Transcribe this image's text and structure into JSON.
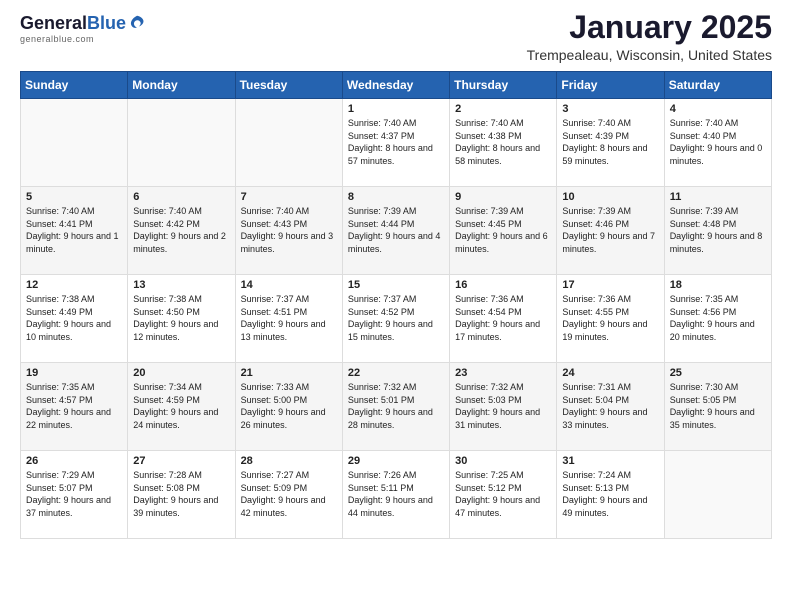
{
  "header": {
    "logo_general": "General",
    "logo_blue": "Blue",
    "month_title": "January 2025",
    "location": "Trempealeau, Wisconsin, United States"
  },
  "days_of_week": [
    "Sunday",
    "Monday",
    "Tuesday",
    "Wednesday",
    "Thursday",
    "Friday",
    "Saturday"
  ],
  "weeks": [
    [
      {
        "day": "",
        "info": ""
      },
      {
        "day": "",
        "info": ""
      },
      {
        "day": "",
        "info": ""
      },
      {
        "day": "1",
        "info": "Sunrise: 7:40 AM\nSunset: 4:37 PM\nDaylight: 8 hours and 57 minutes."
      },
      {
        "day": "2",
        "info": "Sunrise: 7:40 AM\nSunset: 4:38 PM\nDaylight: 8 hours and 58 minutes."
      },
      {
        "day": "3",
        "info": "Sunrise: 7:40 AM\nSunset: 4:39 PM\nDaylight: 8 hours and 59 minutes."
      },
      {
        "day": "4",
        "info": "Sunrise: 7:40 AM\nSunset: 4:40 PM\nDaylight: 9 hours and 0 minutes."
      }
    ],
    [
      {
        "day": "5",
        "info": "Sunrise: 7:40 AM\nSunset: 4:41 PM\nDaylight: 9 hours and 1 minute."
      },
      {
        "day": "6",
        "info": "Sunrise: 7:40 AM\nSunset: 4:42 PM\nDaylight: 9 hours and 2 minutes."
      },
      {
        "day": "7",
        "info": "Sunrise: 7:40 AM\nSunset: 4:43 PM\nDaylight: 9 hours and 3 minutes."
      },
      {
        "day": "8",
        "info": "Sunrise: 7:39 AM\nSunset: 4:44 PM\nDaylight: 9 hours and 4 minutes."
      },
      {
        "day": "9",
        "info": "Sunrise: 7:39 AM\nSunset: 4:45 PM\nDaylight: 9 hours and 6 minutes."
      },
      {
        "day": "10",
        "info": "Sunrise: 7:39 AM\nSunset: 4:46 PM\nDaylight: 9 hours and 7 minutes."
      },
      {
        "day": "11",
        "info": "Sunrise: 7:39 AM\nSunset: 4:48 PM\nDaylight: 9 hours and 8 minutes."
      }
    ],
    [
      {
        "day": "12",
        "info": "Sunrise: 7:38 AM\nSunset: 4:49 PM\nDaylight: 9 hours and 10 minutes."
      },
      {
        "day": "13",
        "info": "Sunrise: 7:38 AM\nSunset: 4:50 PM\nDaylight: 9 hours and 12 minutes."
      },
      {
        "day": "14",
        "info": "Sunrise: 7:37 AM\nSunset: 4:51 PM\nDaylight: 9 hours and 13 minutes."
      },
      {
        "day": "15",
        "info": "Sunrise: 7:37 AM\nSunset: 4:52 PM\nDaylight: 9 hours and 15 minutes."
      },
      {
        "day": "16",
        "info": "Sunrise: 7:36 AM\nSunset: 4:54 PM\nDaylight: 9 hours and 17 minutes."
      },
      {
        "day": "17",
        "info": "Sunrise: 7:36 AM\nSunset: 4:55 PM\nDaylight: 9 hours and 19 minutes."
      },
      {
        "day": "18",
        "info": "Sunrise: 7:35 AM\nSunset: 4:56 PM\nDaylight: 9 hours and 20 minutes."
      }
    ],
    [
      {
        "day": "19",
        "info": "Sunrise: 7:35 AM\nSunset: 4:57 PM\nDaylight: 9 hours and 22 minutes."
      },
      {
        "day": "20",
        "info": "Sunrise: 7:34 AM\nSunset: 4:59 PM\nDaylight: 9 hours and 24 minutes."
      },
      {
        "day": "21",
        "info": "Sunrise: 7:33 AM\nSunset: 5:00 PM\nDaylight: 9 hours and 26 minutes."
      },
      {
        "day": "22",
        "info": "Sunrise: 7:32 AM\nSunset: 5:01 PM\nDaylight: 9 hours and 28 minutes."
      },
      {
        "day": "23",
        "info": "Sunrise: 7:32 AM\nSunset: 5:03 PM\nDaylight: 9 hours and 31 minutes."
      },
      {
        "day": "24",
        "info": "Sunrise: 7:31 AM\nSunset: 5:04 PM\nDaylight: 9 hours and 33 minutes."
      },
      {
        "day": "25",
        "info": "Sunrise: 7:30 AM\nSunset: 5:05 PM\nDaylight: 9 hours and 35 minutes."
      }
    ],
    [
      {
        "day": "26",
        "info": "Sunrise: 7:29 AM\nSunset: 5:07 PM\nDaylight: 9 hours and 37 minutes."
      },
      {
        "day": "27",
        "info": "Sunrise: 7:28 AM\nSunset: 5:08 PM\nDaylight: 9 hours and 39 minutes."
      },
      {
        "day": "28",
        "info": "Sunrise: 7:27 AM\nSunset: 5:09 PM\nDaylight: 9 hours and 42 minutes."
      },
      {
        "day": "29",
        "info": "Sunrise: 7:26 AM\nSunset: 5:11 PM\nDaylight: 9 hours and 44 minutes."
      },
      {
        "day": "30",
        "info": "Sunrise: 7:25 AM\nSunset: 5:12 PM\nDaylight: 9 hours and 47 minutes."
      },
      {
        "day": "31",
        "info": "Sunrise: 7:24 AM\nSunset: 5:13 PM\nDaylight: 9 hours and 49 minutes."
      },
      {
        "day": "",
        "info": ""
      }
    ]
  ]
}
